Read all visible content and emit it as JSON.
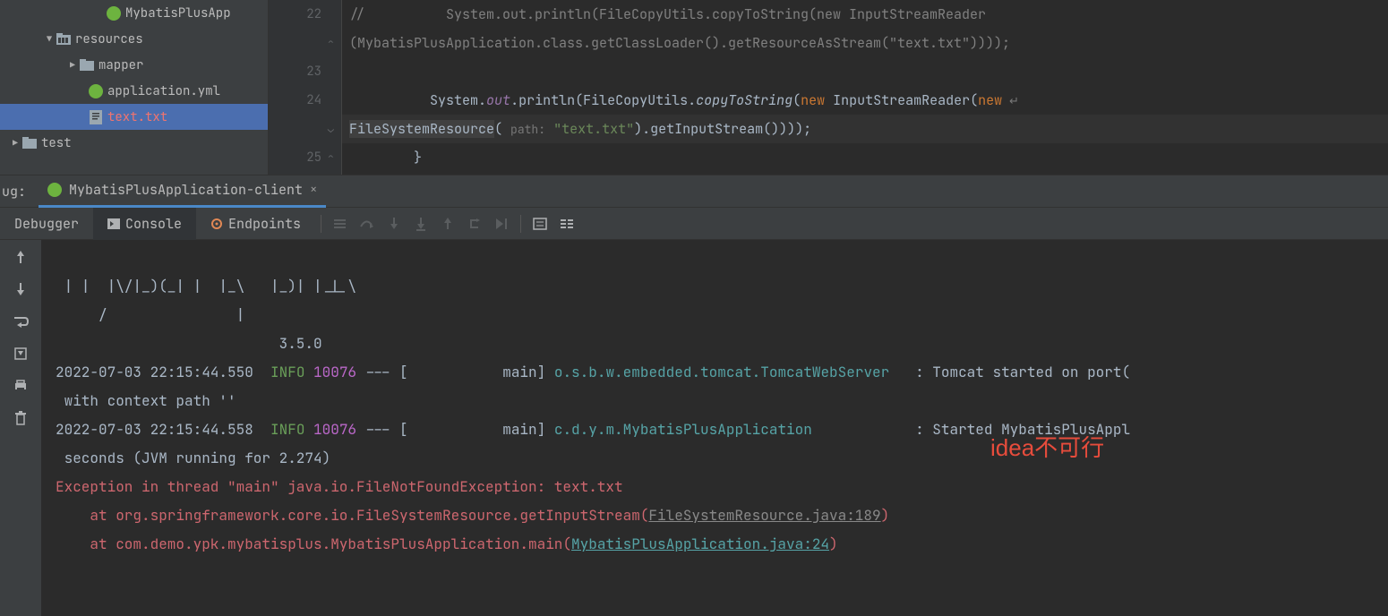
{
  "tree": {
    "mybatisPlusApp": "MybatisPlusApp",
    "resources": "resources",
    "mapper": "mapper",
    "applicationYml": "application.yml",
    "textTxt": "text.txt",
    "test": "test"
  },
  "gutter": {
    "l22": "22",
    "l23": "23",
    "l24": "24",
    "l25": "25"
  },
  "code": {
    "l22a": "//          System.out.println(FileCopyUtils.copyToString(new InputStreamReader",
    "l22b": "(MybatisPlusApplication.class.getClassLoader().getResourceAsStream(\"text.txt\"))));",
    "l24_indent": "          ",
    "l24_System": "System",
    "l24_dot1": ".",
    "l24_out": "out",
    "l24_dot2": ".",
    "l24_println": "println(FileCopyUtils.",
    "l24_copy": "copyToString",
    "l24_paren": "(",
    "l24_new1": "new",
    "l24_isr": " InputStreamReader(",
    "l24_new2": "new",
    "l24_wrap": " ↵",
    "l24b_fsr": "FileSystemResource",
    "l24b_open": "( ",
    "l24b_hint": "path:",
    "l24b_sp": " ",
    "l24b_str": "\"text.txt\"",
    "l24b_tail": ").getInputStream())));",
    "l25": "        }",
    "fold_open": "⌄",
    "fold_close": "⌃"
  },
  "debug": {
    "panelLabel": "ug:",
    "runTab": "MybatisPlusApplication-client",
    "tabDebugger": "Debugger",
    "tabConsole": "Console",
    "tabEndpoints": "Endpoints"
  },
  "console": {
    "ascii1": " | |  |\\/|_)(_| |  |_\\   |_)| |_|_\\",
    "ascii2": "     /               |",
    "ascii3": "                          3.5.0",
    "ts1": "2022-07-03 22:15:44.550  ",
    "info": "INFO",
    "pid": " 10076",
    "sep1": " --- [           main] ",
    "logger1": "o.s.b.w.embedded.tomcat.TomcatWebServer",
    "pad1": "   ",
    "msg1": ": Tomcat started on port(",
    "cont1": " with context path ''",
    "ts2": "2022-07-03 22:15:44.558  ",
    "logger2": "c.d.y.m.MybatisPlusApplication",
    "pad2": "            ",
    "msg2": ": Started MybatisPlusAppl",
    "cont2": " seconds (JVM running for 2.274)",
    "ex1": "Exception in thread \"main\" java.io.FileNotFoundException: text.txt",
    "ex2a": "    at org.springframework.core.io.FileSystemResource.getInputStream(",
    "ex2b": "FileSystemResource.java:189",
    "ex2c": ")",
    "ex3a": "    at com.demo.ypk.mybatisplus.MybatisPlusApplication.main(",
    "ex3b": "MybatisPlusApplication.java:24",
    "ex3c": ")"
  },
  "overlay": "idea不可行"
}
